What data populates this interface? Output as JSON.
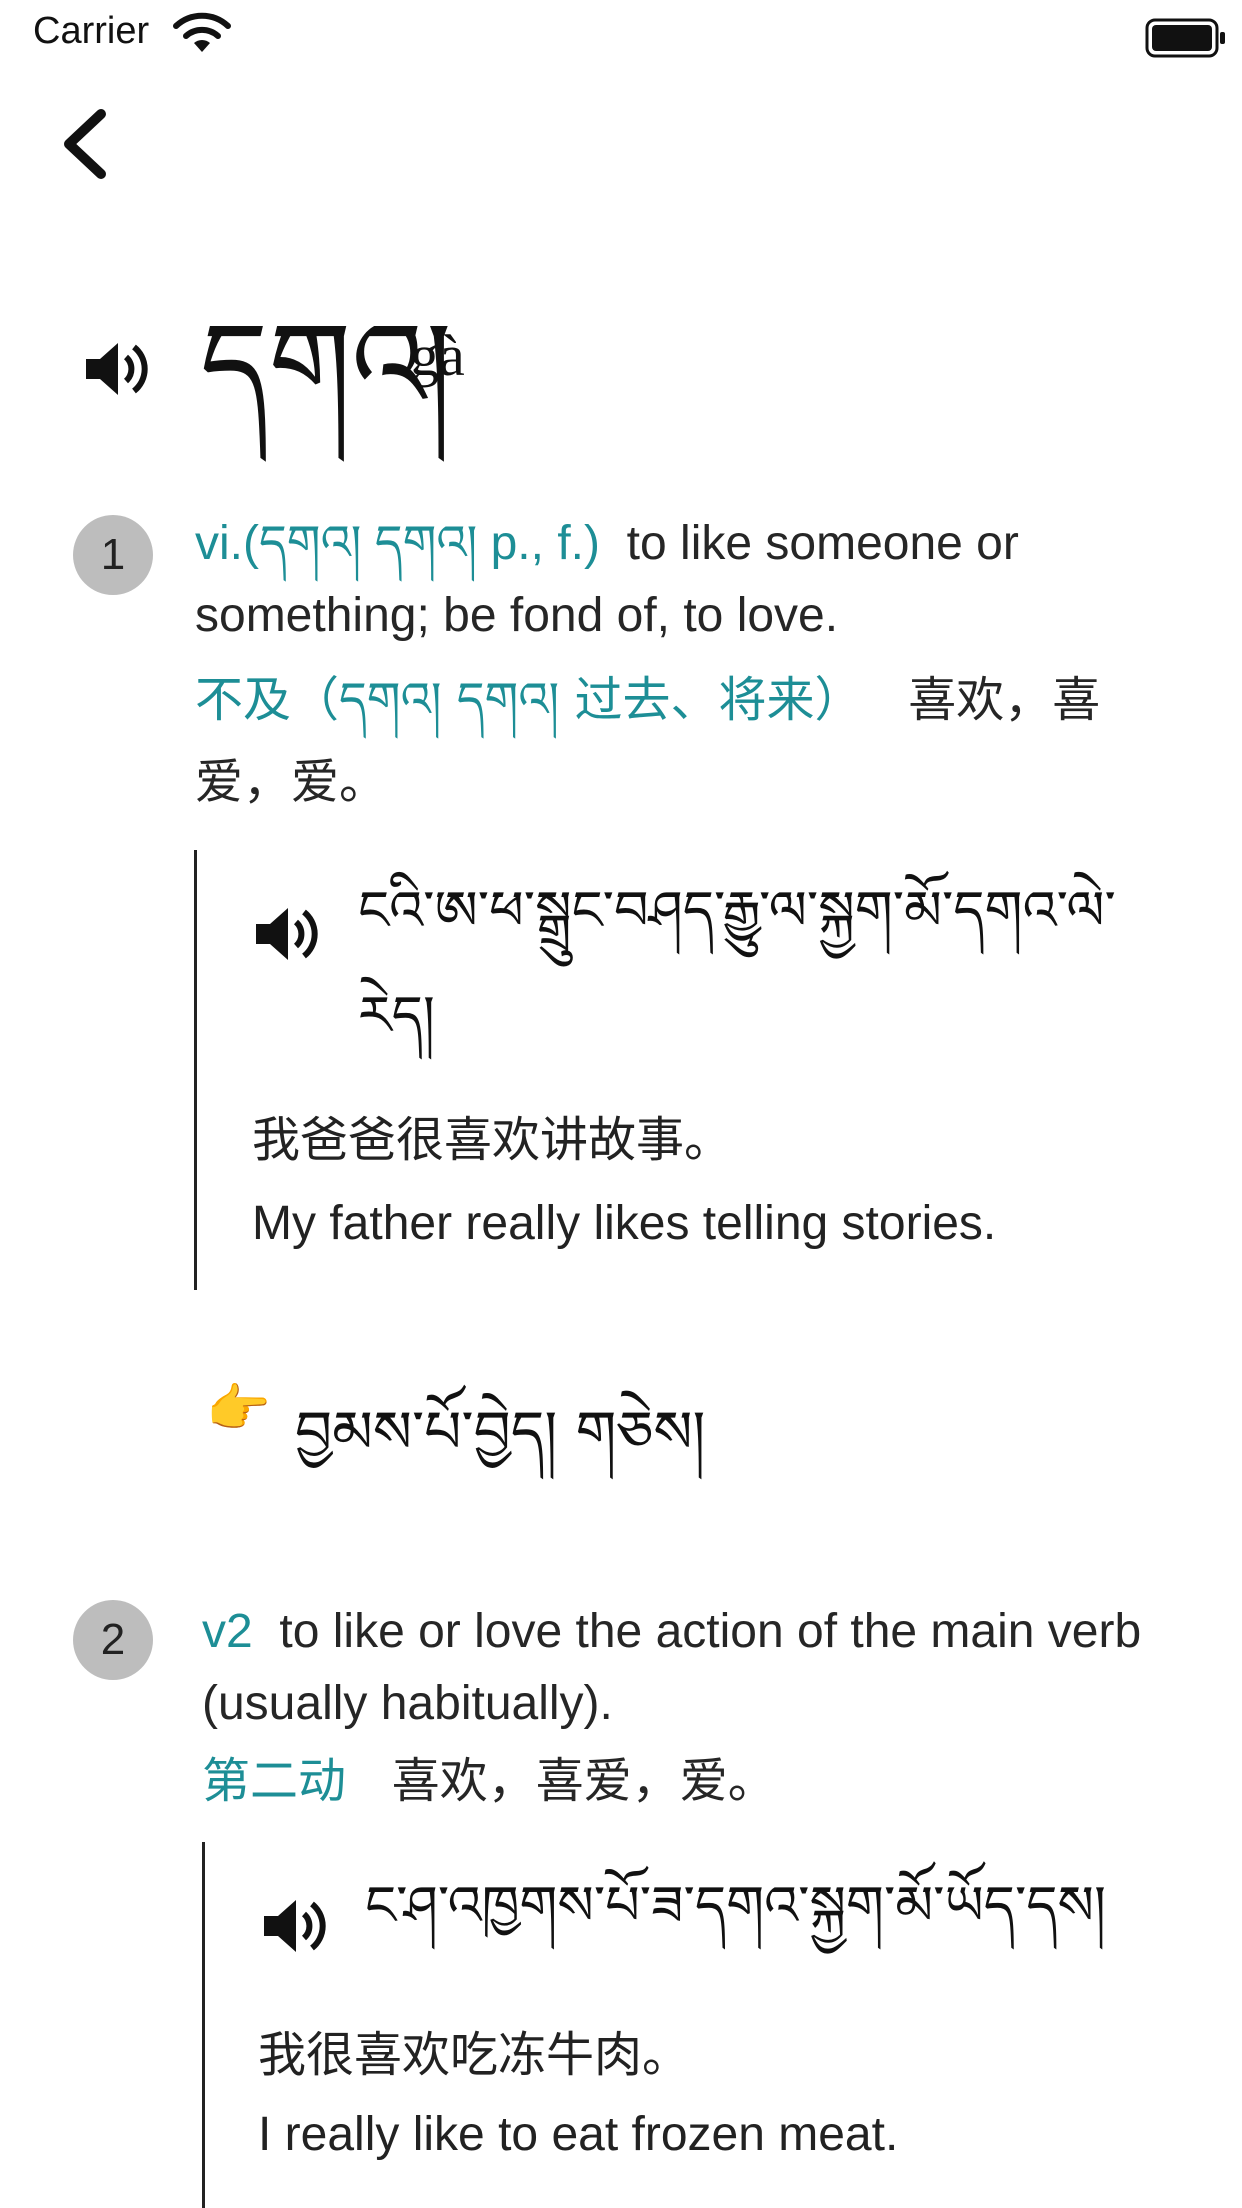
{
  "status_bar": {
    "carrier": "Carrier"
  },
  "entry": {
    "headword": "དགའ།",
    "pronunciation": "gà"
  },
  "senses": [
    {
      "number": "1",
      "pos_en": "vi.(དགའ། དགའ། p., f.)",
      "def_en": "to like someone or something; be fond of, to love.",
      "pos_zh": "不及（དགའ། དགའ། 过去、将来）",
      "def_zh": "喜欢，喜爱，爱。",
      "example": {
        "tibetan": "ངའི་ཨ་ཕ་སྒྲུང་བཤད་རྒྱུ་ལ་སྐྱག་མོ་དགའ་ལེ་རེད།",
        "chinese": "我爸爸很喜欢讲故事。",
        "english": "My father really likes telling stories."
      },
      "see_also_icon": "pointing-hand",
      "see_also": "བྱམས་པོ་བྱེད།  གཅེས།"
    },
    {
      "number": "2",
      "pos_en": "v2",
      "def_en": "to like or love the action of the main verb (usually habitually).",
      "pos_zh": "第二动",
      "def_zh": "喜欢，喜爱，爱。",
      "example": {
        "tibetan": "ང་ཤ་འཁྱགས་པོ་ཟ་དགའ་སྐྱག་མོ་ཡོད་དས།",
        "chinese": "我很喜欢吃冻牛肉。",
        "english": "I really like to eat frozen meat."
      }
    }
  ],
  "colors": {
    "accent": "#1d8e96",
    "badge": "#bdbdbd"
  }
}
